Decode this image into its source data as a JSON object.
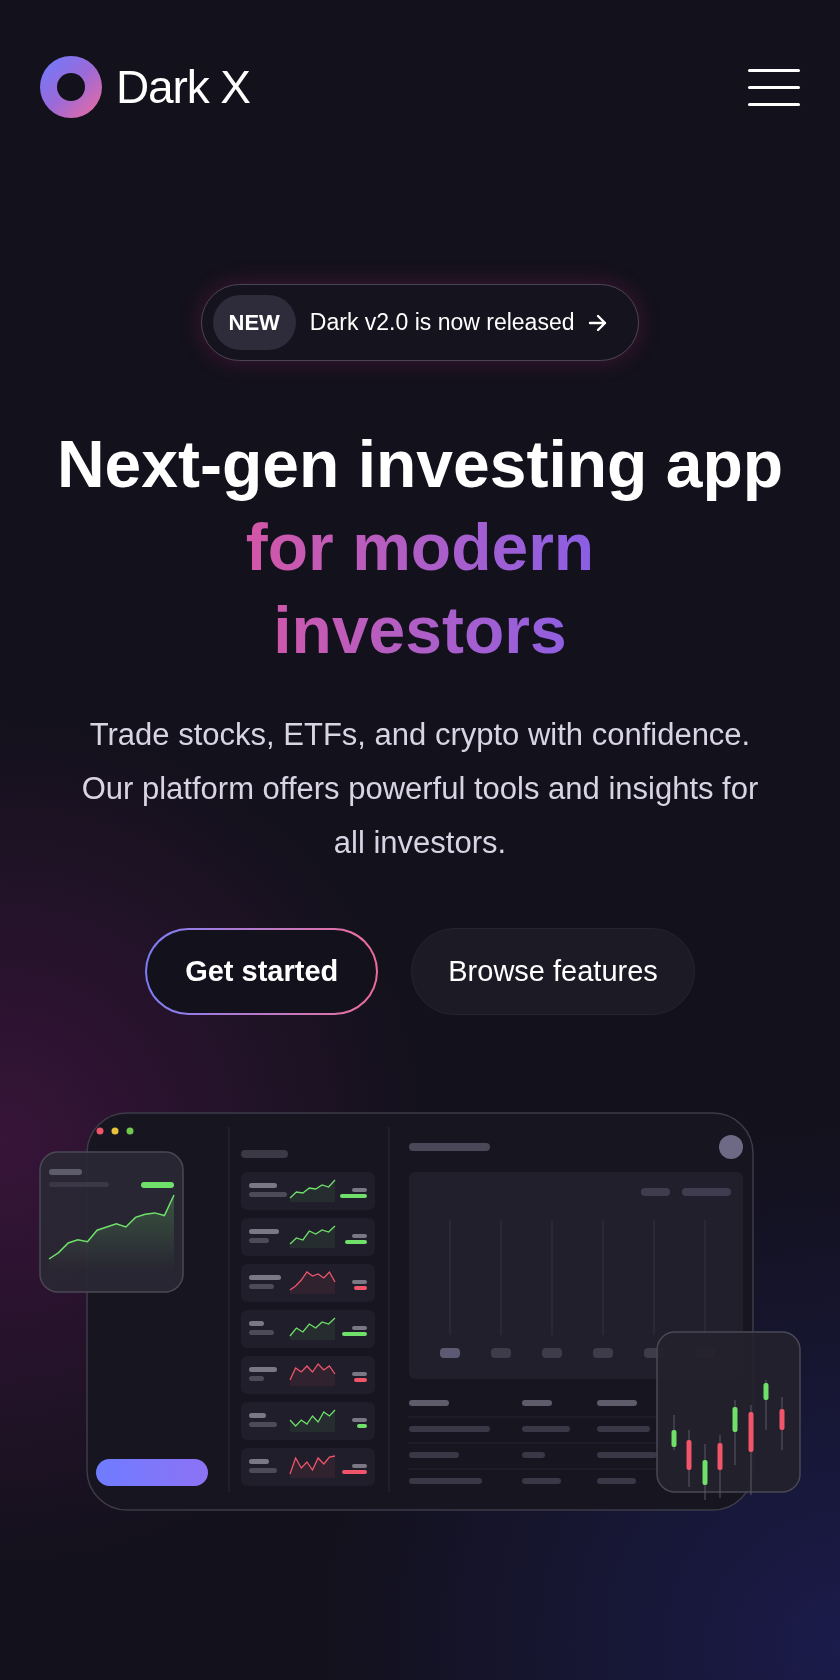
{
  "nav": {
    "brand": "Dark X"
  },
  "announcement": {
    "tag": "NEW",
    "text": "Dark v2.0 is now released"
  },
  "hero": {
    "title": "Next-gen investing app",
    "highlight": "for modern investors",
    "description": "Trade stocks, ETFs, and crypto with confidence. Our platform offers powerful tools and insights for all investors."
  },
  "buttons": [
    {
      "label": "Get started",
      "kind": "primary"
    },
    {
      "label": "Browse features",
      "kind": "secondary"
    }
  ]
}
